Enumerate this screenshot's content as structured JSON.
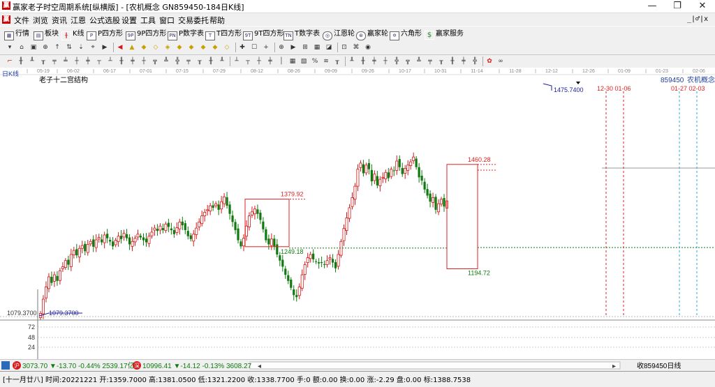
{
  "window": {
    "title": "赢家老子时空周期系统[纵横版] - [农机概念  GN859450-184日K线]",
    "minimize": "—",
    "restore": "❐",
    "close": "✕"
  },
  "menu": {
    "items": [
      "文件",
      "浏览",
      "资讯",
      "江恩",
      "公式选股",
      "设置",
      "工具",
      "窗口",
      "交易委托",
      "帮助"
    ],
    "mdi_controls": "_|♂|x"
  },
  "toolbar1": {
    "items": [
      {
        "icon": "grid-icon",
        "label": "行情"
      },
      {
        "icon": "blocks-icon",
        "label": "板块"
      },
      {
        "icon": "kline-icon",
        "label": "K线"
      },
      {
        "icon": "p-icon",
        "label": "P四方形"
      },
      {
        "icon": "9p-icon",
        "label": "9P四方形"
      },
      {
        "icon": "p-table-icon",
        "label": "P数字表"
      },
      {
        "icon": "t-icon",
        "label": "T四方形"
      },
      {
        "icon": "9t-icon",
        "label": "9T四方形"
      },
      {
        "icon": "tn-icon",
        "label": "T数字表"
      },
      {
        "icon": "gann-wheel-icon",
        "label": "江恩轮"
      },
      {
        "icon": "winner-wheel-icon",
        "label": "赢家轮"
      },
      {
        "icon": "hexagon-icon",
        "label": "六角形"
      },
      {
        "icon": "dollar-icon",
        "label": "赢家服务"
      }
    ]
  },
  "chart": {
    "period_label": "日K线",
    "indicator_label": "老子十二宫结构",
    "code_label": "859450",
    "name_label": "农机概念",
    "x_dates": [
      "05-19",
      "06-02",
      "06-17",
      "07-01",
      "07-15",
      "07-29",
      "08-12",
      "08-26",
      "09-09",
      "09-26",
      "10-17",
      "10-31",
      "11-14",
      "11-28",
      "12-12",
      "12-26",
      "01-09",
      "01-23",
      "02-06"
    ],
    "y_axis_low_label": "1079.3700",
    "vol_labels": [
      "72",
      "48",
      "24"
    ],
    "annotations": {
      "box1_high": "1379.92",
      "box1_low": "1249.18",
      "box2_high": "1460.28",
      "box2_low": "1194.72",
      "peak": "1475.7400",
      "low_price": "1079.3700",
      "future_dates_top": "12-30  01-06",
      "future_dates_bottom": "01-27  02-03"
    },
    "colors": {
      "up": "#d41818",
      "down": "#0f7a0f",
      "box": "#e02020",
      "low_line": "#20209a",
      "future_blue": "#2aa8d8",
      "future_red": "#e02020"
    }
  },
  "status": {
    "index1_name": "沪",
    "index1": "3073.70 ▼-13.70 -0.44% 2539.17亿",
    "index2_name": "深",
    "index2": "10996.41 ▼-14.12 -0.13% 3608.27",
    "stock_label": "收859450日线",
    "info": "[十一月廿八] 时间:20221221 开:1359.7000 高:1381.0500 低:1321.2200 收:1338.7700 手:0 额:0.00 换:0.00 涨:-2.29 盘:0.00 标:1388.7538"
  }
}
